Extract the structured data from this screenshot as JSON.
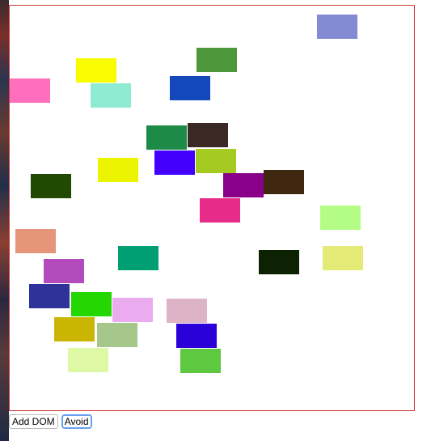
{
  "controls": {
    "add_dom_label": "Add DOM",
    "avoid_label": "Avoid"
  },
  "colors": {
    "canvas_border": "#d43a3a",
    "focus_ring": "#6aa0f0"
  },
  "rects": [
    {
      "color": "#8489d3"
    },
    {
      "color": "#4c983a"
    },
    {
      "color": "#f9fc00"
    },
    {
      "color": "#ff6fbe"
    },
    {
      "color": "#1449bb"
    },
    {
      "color": "#8eead0"
    },
    {
      "color": "#1e8a48"
    },
    {
      "color": "#3a2825"
    },
    {
      "color": "#4400fd"
    },
    {
      "color": "#a5cb22"
    },
    {
      "color": "#ecf400"
    },
    {
      "color": "#214901"
    },
    {
      "color": "#890189"
    },
    {
      "color": "#3f2710"
    },
    {
      "color": "#e62b88"
    },
    {
      "color": "#b3fd87"
    },
    {
      "color": "#e6957a"
    },
    {
      "color": "#009e73"
    },
    {
      "color": "#b34bbd"
    },
    {
      "color": "#0d2203"
    },
    {
      "color": "#e4ea76"
    },
    {
      "color": "#2e3299"
    },
    {
      "color": "#24d700"
    },
    {
      "color": "#ebabf1"
    },
    {
      "color": "#ddb3c6"
    },
    {
      "color": "#cbb503"
    },
    {
      "color": "#a6c78a"
    },
    {
      "color": "#2c00d9"
    },
    {
      "color": "#ddf9a6"
    },
    {
      "color": "#5dc840"
    }
  ]
}
